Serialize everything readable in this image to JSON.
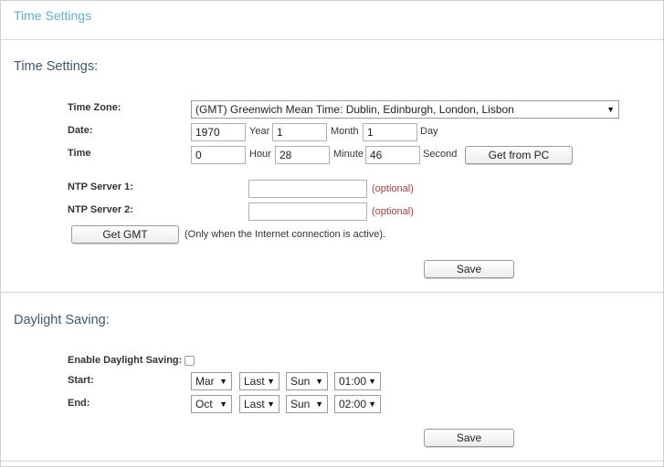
{
  "page_title": "Time Settings",
  "time_settings": {
    "section_title": "Time Settings:",
    "time_zone_label": "Time Zone:",
    "time_zone_value": "(GMT) Greenwich Mean Time: Dublin, Edinburgh, London, Lisbon",
    "date_label": "Date:",
    "date": {
      "year": "1970",
      "year_unit": "Year",
      "month": "1",
      "month_unit": "Month",
      "day": "1",
      "day_unit": "Day"
    },
    "time_label": "Time",
    "time": {
      "hour": "0",
      "hour_unit": "Hour",
      "minute": "28",
      "minute_unit": "Minute",
      "second": "46",
      "second_unit": "Second"
    },
    "get_from_pc_label": "Get from PC",
    "ntp1_label": "NTP Server 1:",
    "ntp1_value": "",
    "ntp2_label": "NTP Server 2:",
    "ntp2_value": "",
    "optional_text": "(optional)",
    "get_gmt_label": "Get GMT",
    "get_gmt_note": "(Only when the Internet connection is active).",
    "save_label": "Save"
  },
  "daylight_saving": {
    "section_title": "Daylight Saving:",
    "enable_label": "Enable Daylight Saving:",
    "enabled": false,
    "start_label": "Start:",
    "start": {
      "month": "Mar",
      "week": "Last",
      "day": "Sun",
      "time": "01:00"
    },
    "end_label": "End:",
    "end": {
      "month": "Oct",
      "week": "Last",
      "day": "Sun",
      "time": "02:00"
    },
    "save_label": "Save"
  },
  "icons": {
    "dropdown": "dropdown-arrow-icon",
    "checkbox": "checkbox-icon"
  },
  "colors": {
    "page_title": "#5bb2cf",
    "section_title": "#3e5871",
    "optional": "#b03a3a"
  }
}
